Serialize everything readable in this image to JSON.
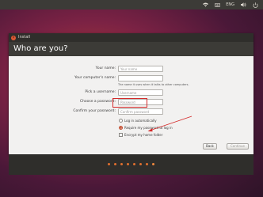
{
  "top_panel": {
    "keyboard_layout": "ENG",
    "icons": [
      "network-icon",
      "keyboard-indicator",
      "volume-icon",
      "power-icon"
    ]
  },
  "window": {
    "title": "Install",
    "close_glyph": "×",
    "heading": "Who are you?"
  },
  "form": {
    "name": {
      "label": "Your name:",
      "value": "",
      "placeholder": "Your name"
    },
    "computer_name": {
      "label": "Your computer's name:",
      "value": "",
      "placeholder": "",
      "hint": "The name it uses when it talks to other computers."
    },
    "username": {
      "label": "Pick a username:",
      "value": "",
      "placeholder": "Username"
    },
    "password": {
      "label": "Choose a password:",
      "value": "",
      "placeholder": "Password"
    },
    "confirm": {
      "label": "Confirm your password:",
      "value": "",
      "placeholder": "Confirm password"
    },
    "options": {
      "auto_login": "Log in automatically",
      "require_password": "Require my password to log in",
      "encrypt_home": "Encrypt my home folder"
    },
    "selected_option": "require_password",
    "encrypt_home_checked": false
  },
  "buttons": {
    "back": "Back",
    "continue": "Continue"
  },
  "progress": {
    "total_steps": 8,
    "current_step": 8
  },
  "colors": {
    "accent": "#e0702e",
    "highlight": "#d42a2a",
    "panel": "#3c3b37"
  }
}
